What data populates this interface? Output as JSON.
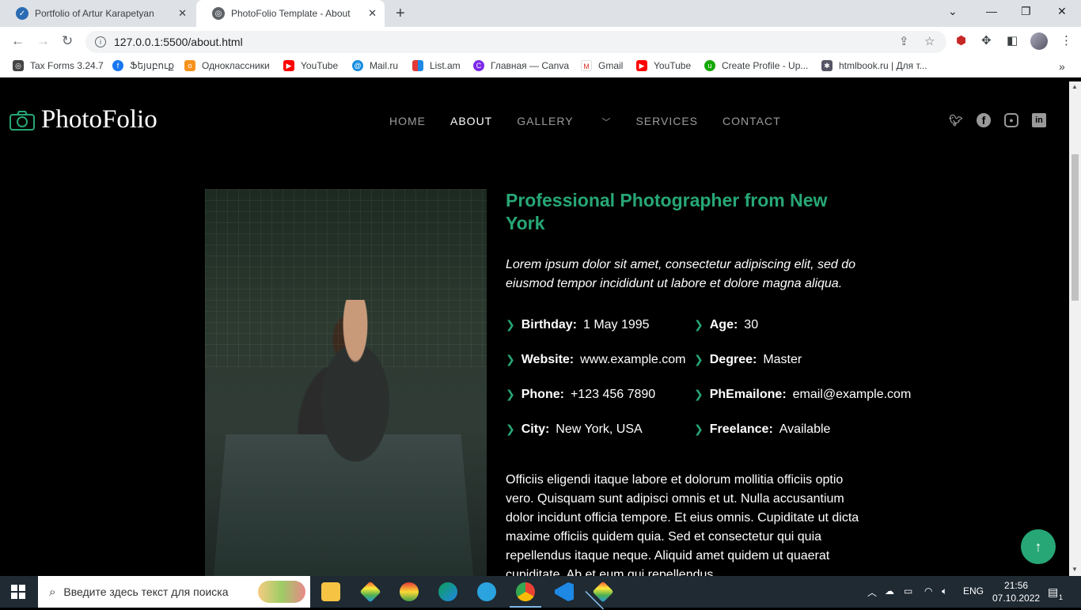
{
  "browser": {
    "tabs": [
      {
        "title": "Portfolio of Artur Karapetyan",
        "active": false
      },
      {
        "title": "PhotoFolio Template - About",
        "active": true
      }
    ],
    "url": "127.0.0.1:5500/about.html",
    "bookmarks": [
      "Tax Forms 3.24.7",
      "Ֆեյսբուք",
      "Одноклассники",
      "YouTube",
      "Mail.ru",
      "List.am",
      "Главная — Canva",
      "Gmail",
      "YouTube",
      "Create Profile - Up...",
      "htmlbook.ru | Для т..."
    ]
  },
  "site": {
    "logo": "PhotoFolio",
    "nav": [
      "HOME",
      "ABOUT",
      "GALLERY",
      "SERVICES",
      "CONTACT"
    ],
    "active_nav": "ABOUT",
    "socials": [
      "twitter-icon",
      "facebook-icon",
      "instagram-icon",
      "linkedin-icon"
    ],
    "accent": "#27a776"
  },
  "about": {
    "headline": "Professional Photographer from New York",
    "lead": "Lorem ipsum dolor sit amet, consectetur adipiscing elit, sed do eiusmod tempor incididunt ut labore et dolore magna aliqua.",
    "facts": [
      {
        "label": "Birthday:",
        "value": "1 May 1995"
      },
      {
        "label": "Age:",
        "value": "30"
      },
      {
        "label": "Website:",
        "value": "www.example.com"
      },
      {
        "label": "Degree:",
        "value": "Master"
      },
      {
        "label": "Phone:",
        "value": "+123 456 7890"
      },
      {
        "label": "PhEmailone:",
        "value": "email@example.com"
      },
      {
        "label": "City:",
        "value": "New York, USA"
      },
      {
        "label": "Freelance:",
        "value": "Available"
      }
    ],
    "body": "Officiis eligendi itaque labore et dolorum mollitia officiis optio vero. Quisquam sunt adipisci omnis et ut. Nulla accusantium dolor incidunt officia tempore. Et eius omnis. Cupiditate ut dicta maxime officiis quidem quia. Sed et consectetur qui quia repellendus itaque neque. Aliquid amet quidem ut quaerat cupiditate. Ab et eum qui repellendus"
  },
  "taskbar": {
    "search_placeholder": "Введите здесь текст для поиска",
    "lang": "ENG",
    "time": "21:56",
    "date": "07.10.2022",
    "notifications": "1"
  }
}
